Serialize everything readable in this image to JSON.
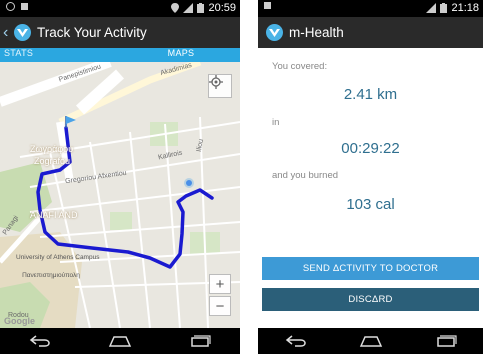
{
  "left_screen": {
    "status_time": "20:59",
    "title": "Track Your Activity",
    "tabs": [
      {
        "label": "STATS",
        "active": false
      },
      {
        "label": "MAPS",
        "active": true
      }
    ],
    "map_labels": {
      "street_top": "Panepistimiou",
      "street_top2": "Akadimias",
      "area": "Ζωγράφου",
      "area_en": "Zografou",
      "street_mid": "Gregoriou Afxentiou",
      "street_right": "Kallirois",
      "street_right2": "Iliou",
      "street_left": "Panagi",
      "anafi": "ANAFI AND",
      "campus_en": "University of Athens Campus",
      "campus_gr": "Πανεπιστημιούπολη",
      "bottom": "Google",
      "bottom2": "Rodou"
    },
    "zoom_in": "+",
    "zoom_out": "−"
  },
  "right_screen": {
    "status_time": "21:18",
    "title": "m-Health",
    "covered_label": "You covered:",
    "distance": "2.41 km",
    "in_label": "in",
    "duration": "00:29:22",
    "burned_label": "and you burned",
    "calories": "103 cal",
    "send_button": "SEND ΔCTIVITY TO DOCTOR",
    "discard_button": "DISCΔRD"
  },
  "colors": {
    "accent": "#2ba7e0",
    "route": "#1a1ad0",
    "send": "#3d9ad6",
    "discard": "#2b5f79",
    "value_text": "#2f6f8f"
  },
  "icons": [
    "logo-icon",
    "location-pin-icon",
    "wifi-icon",
    "signal-icon",
    "battery-icon",
    "my-location-icon",
    "back-nav-icon",
    "home-nav-icon",
    "recents-nav-icon"
  ]
}
